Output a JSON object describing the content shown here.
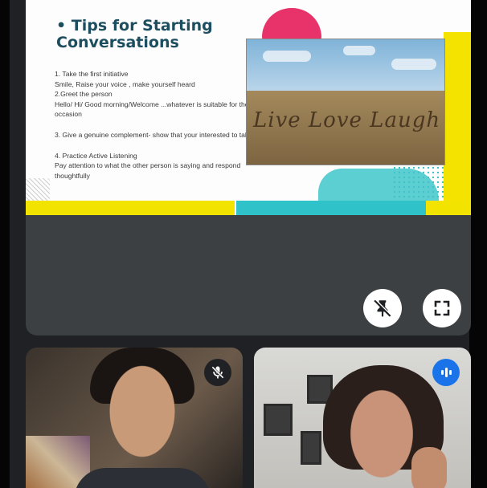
{
  "slide": {
    "title": "• Tips for Starting Conversations",
    "lines": [
      "1. Take the first initiative",
      "Smile, Raise your voice , make yourself heard",
      "2.Greet the person",
      "Hello/ Hi/ Good morning/Welcome ...whatever is suitable for the occasion",
      "3. Give a genuine complement- show that your interested to talk",
      "4. Practice Active Listening",
      "Pay attention to what the other person is saying and respond thoughtfully"
    ],
    "photo_text": "Live Love Laugh ♥"
  },
  "controls": {
    "unpin_icon": "unpin-icon",
    "fullscreen_icon": "fullscreen-icon"
  },
  "participants": [
    {
      "status_icon": "mic-off-icon"
    },
    {
      "status_icon": "speaking-indicator-icon",
      "accent": "#1a73e8"
    }
  ],
  "colors": {
    "background": "#202124",
    "slide_title": "#1d4e5f",
    "accent_pink": "#e8336a",
    "accent_yellow": "#f2e300",
    "accent_teal": "#2fc2c8"
  }
}
